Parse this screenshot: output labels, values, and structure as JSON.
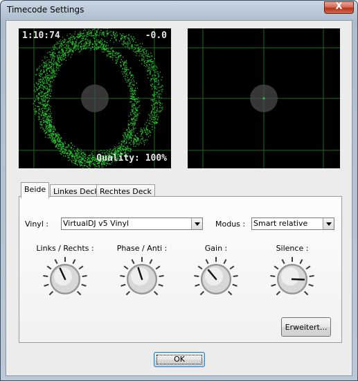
{
  "window": {
    "title": "Timecode Settings",
    "close_symbol": "X"
  },
  "scope_left": {
    "time": "1:10:74",
    "pitch": "-0.0",
    "quality": "Quality: 100%",
    "colors": {
      "background": "#000000",
      "grid": "#1f6b1f",
      "signal": "#22c82a"
    }
  },
  "scope_right": {
    "colors": {
      "background": "#000000",
      "grid": "#1f6b1f",
      "signal": "#22c82a"
    }
  },
  "tabs": [
    {
      "label": "Beide",
      "active": true
    },
    {
      "label": "Linkes Deck",
      "active": false
    },
    {
      "label": "Rechtes Deck",
      "active": false
    }
  ],
  "vinyl": {
    "label": "Vinyl :",
    "value": "VirtualDJ v5 Vinyl"
  },
  "mode": {
    "label": "Modus :",
    "value": "Smart relative"
  },
  "knobs": [
    {
      "label": "Links / Rechts :",
      "angle_deg": -25
    },
    {
      "label": "Phase / Anti :",
      "angle_deg": -18
    },
    {
      "label": "Gain :",
      "angle_deg": -40
    },
    {
      "label": "Silence :",
      "angle_deg": 92
    }
  ],
  "buttons": {
    "advanced": "Erweitert...",
    "ok": "OK"
  }
}
